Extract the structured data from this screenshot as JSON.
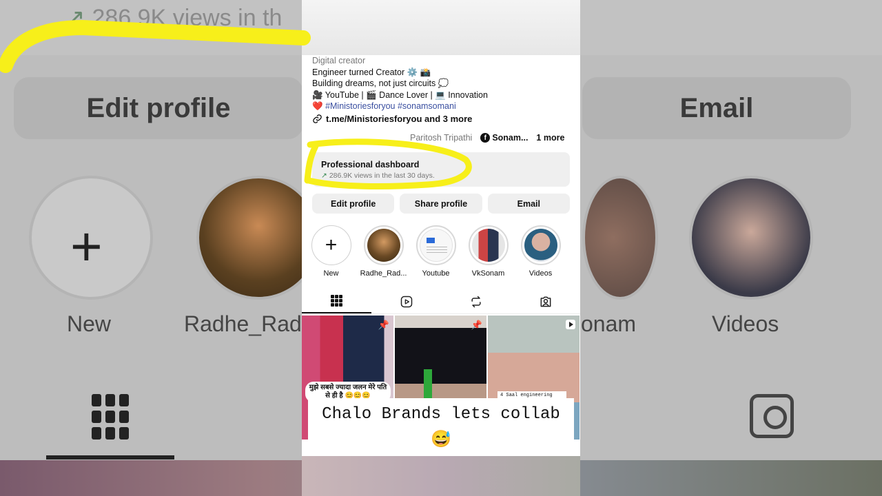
{
  "background": {
    "views_text": "286.9K views in th",
    "edit_label": "Edit profile",
    "email_label": "Email",
    "new_label": "New",
    "radhe_label": "Radhe_Rad",
    "vk_label": "onam",
    "videos_label": "Videos"
  },
  "profile": {
    "category": "Digital creator",
    "bio_lines": [
      "Engineer turned Creator ⚙️ 📸",
      "Building dreams, not just circuits 💭",
      "🎥 YouTube | 🎬 Dance Lover | 💻 Innovation"
    ],
    "bio_tags_prefix": "❤️",
    "bio_tags": "#Ministoriesforyou #sonamsomani",
    "link": "t.me/Ministoriesforyou and 3 more",
    "mention_partial": "Paritosh Tripathi",
    "facebook": "Sonam...",
    "more": "1 more"
  },
  "dashboard": {
    "title": "Professional dashboard",
    "arrow": "↗",
    "subtitle": "286.9K views in the last 30 days."
  },
  "buttons": {
    "edit": "Edit profile",
    "share": "Share profile",
    "email": "Email"
  },
  "highlights": [
    {
      "label": "New"
    },
    {
      "label": "Radhe_Rad..."
    },
    {
      "label": "Youtube"
    },
    {
      "label": "VkSonam"
    },
    {
      "label": "Videos"
    }
  ],
  "posts": {
    "caption1": "मुझे सबसे ज्यादा जलन मेरे पति से ही है 😊😊😊",
    "caption3": "4 Saal engineering"
  },
  "overlay": {
    "line1": "Chalo Brands lets collab 😅",
    "line2": "🤫😂"
  },
  "colors": {
    "highlight_yellow": "#f7ef1a",
    "hashtag_blue": "#3a4fa0"
  }
}
